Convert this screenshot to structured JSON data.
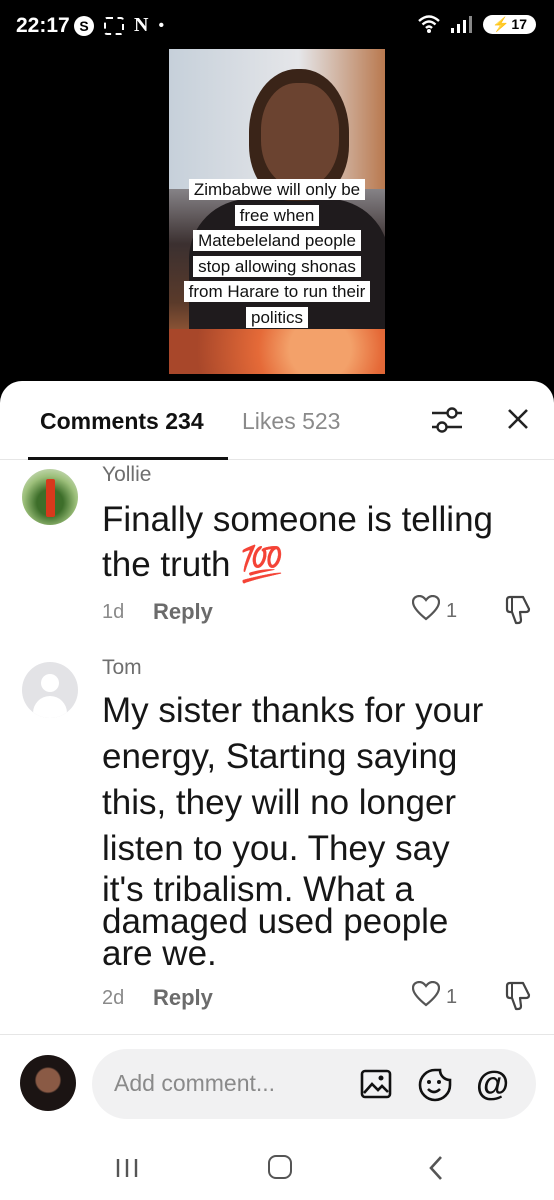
{
  "status_bar": {
    "time": "22:17",
    "s_badge": "S",
    "n_letter": "N",
    "dot": "•",
    "signal_label": "5",
    "battery": "17"
  },
  "video": {
    "caption_lines": [
      "Zimbabwe will only be",
      "free when",
      "Matebeleland people",
      "stop allowing shonas",
      "from Harare to run their",
      "politics"
    ]
  },
  "tabs": {
    "comments": "Comments 234",
    "likes": "Likes 523"
  },
  "comments": [
    {
      "user": "Yollie",
      "text_lines": [
        "Finally someone is telling",
        "the truth 💯"
      ],
      "time": "1d",
      "reply": "Reply",
      "likes": "1"
    },
    {
      "user": "Tom",
      "text_lines": [
        "My sister thanks for your",
        "energy, Starting saying",
        "this, they will no longer",
        "listen to you. They say",
        "it's tribalism. What a",
        "damaged used people",
        "are we."
      ],
      "time": "2d",
      "reply": "Reply",
      "likes": "1"
    }
  ],
  "composer": {
    "placeholder": "Add comment...",
    "at": "@"
  }
}
